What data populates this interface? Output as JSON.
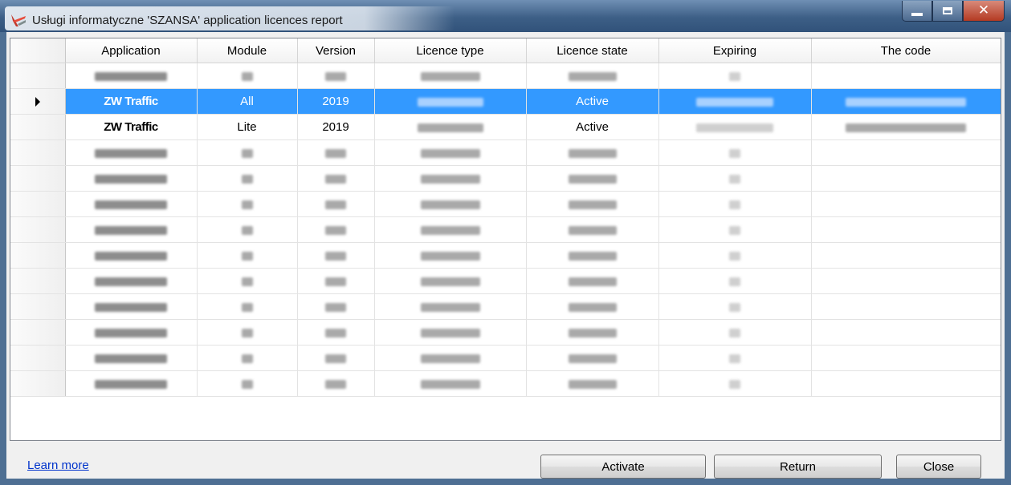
{
  "window": {
    "title": "Usługi informatyczne 'SZANSA' application licences report",
    "icon": "licence-report-app-icon"
  },
  "columns": [
    "Application",
    "Module",
    "Version",
    "Licence type",
    "Licence state",
    "Expiring",
    "The code"
  ],
  "rows": [
    {
      "app": "",
      "module": "",
      "version": "",
      "type": "",
      "state": "",
      "expiring": "",
      "code": ""
    },
    {
      "app": "ZW Traffic",
      "module": "All",
      "version": "2019",
      "type": "",
      "state": "Active",
      "expiring": "",
      "code": "",
      "selected": true
    },
    {
      "app": "ZW Traffic",
      "module": "Lite",
      "version": "2019",
      "type": "",
      "state": "Active",
      "expiring": "",
      "code": ""
    },
    {
      "app": "",
      "module": "",
      "version": "",
      "type": "",
      "state": "",
      "expiring": "",
      "code": ""
    },
    {
      "app": "",
      "module": "",
      "version": "",
      "type": "",
      "state": "",
      "expiring": "",
      "code": ""
    },
    {
      "app": "",
      "module": "",
      "version": "",
      "type": "",
      "state": "",
      "expiring": "",
      "code": ""
    },
    {
      "app": "",
      "module": "",
      "version": "",
      "type": "",
      "state": "",
      "expiring": "",
      "code": ""
    },
    {
      "app": "",
      "module": "",
      "version": "",
      "type": "",
      "state": "",
      "expiring": "",
      "code": ""
    },
    {
      "app": "",
      "module": "",
      "version": "",
      "type": "",
      "state": "",
      "expiring": "",
      "code": ""
    },
    {
      "app": "",
      "module": "",
      "version": "",
      "type": "",
      "state": "",
      "expiring": "",
      "code": ""
    },
    {
      "app": "",
      "module": "",
      "version": "",
      "type": "",
      "state": "",
      "expiring": "",
      "code": ""
    },
    {
      "app": "",
      "module": "",
      "version": "",
      "type": "",
      "state": "",
      "expiring": "",
      "code": ""
    },
    {
      "app": "",
      "module": "",
      "version": "",
      "type": "",
      "state": "",
      "expiring": "",
      "code": ""
    }
  ],
  "footer": {
    "learn_more": "Learn more",
    "activate": "Activate",
    "return": "Return",
    "close": "Close"
  },
  "colors": {
    "selection": "#3399ff",
    "link": "#0033cc",
    "titlebar": "#3d5f86"
  }
}
